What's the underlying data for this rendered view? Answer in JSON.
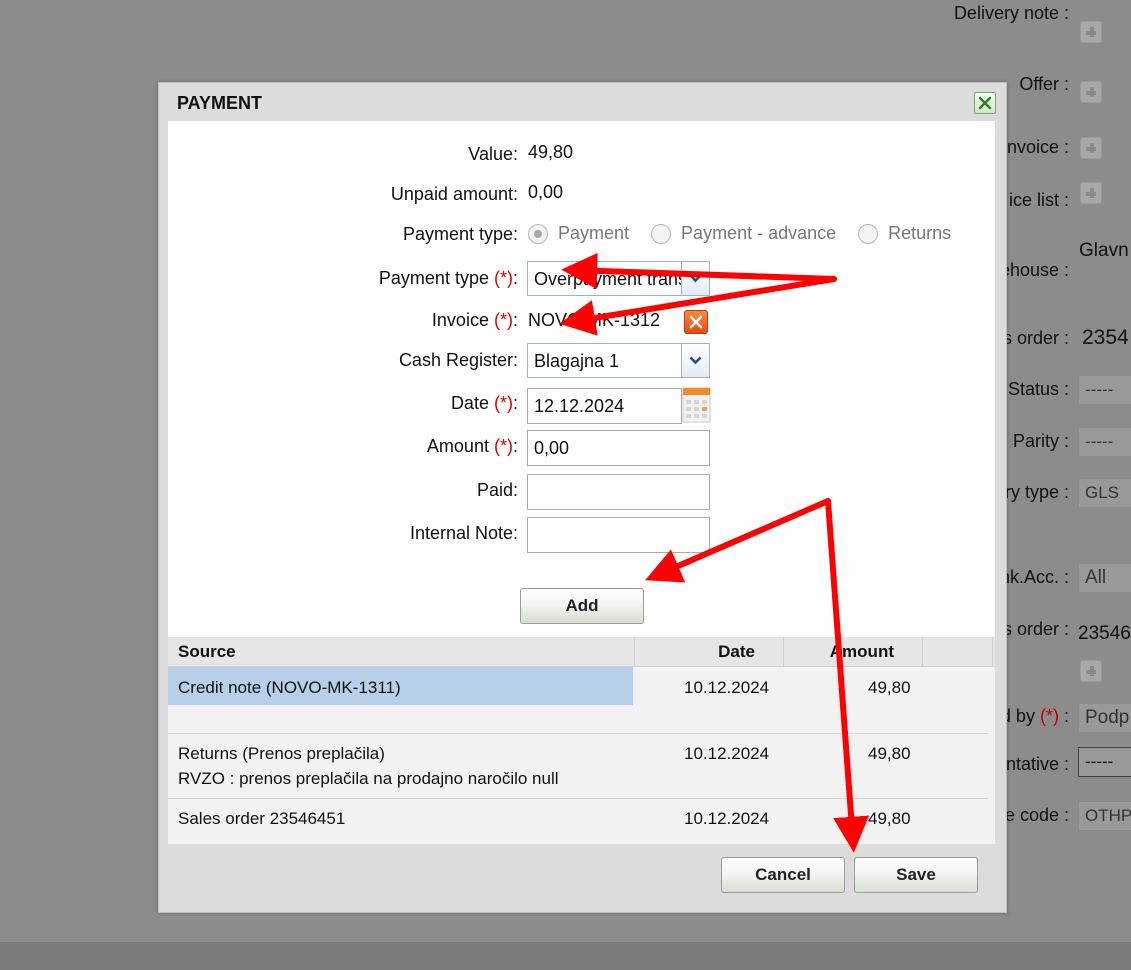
{
  "background": {
    "delivery_note_label": "Delivery note :",
    "offer_label": "Offer :",
    "invoice_label": "nvoice :",
    "price_list_label": "ice list :",
    "warehouse_label": "ehouse :",
    "warehouse_value": "Glavn",
    "order_label": "s order :",
    "order_value": "2354",
    "status_label": "Status :",
    "status_value": "-----",
    "parity_label": "Parity :",
    "parity_value": "-----",
    "delivery_type_label": "ry type :",
    "delivery_type_value": "GLS",
    "bank_acc_label": "nk.Acc. :",
    "bank_acc_value": "All",
    "sales_order_label": "s order :",
    "sales_order_value": "23546",
    "by_label": "d by",
    "by_req": "(*)",
    "by_colon": ":",
    "by_value": "Podp",
    "representative_label": "ntative :",
    "representative_value": "-----",
    "code_label": "e code :",
    "code_value": "OTHP"
  },
  "dialog": {
    "title": "PAYMENT",
    "close_icon": "close-icon",
    "value_label": "Value:",
    "value": "49,80",
    "unpaid_label": "Unpaid amount:",
    "unpaid": "0,00",
    "payment_type_radio_label": "Payment type:",
    "radios": [
      {
        "label": "Payment",
        "checked": true
      },
      {
        "label": "Payment - advance",
        "checked": false
      },
      {
        "label": "Returns",
        "checked": false
      }
    ],
    "payment_type_select_label": "Payment type",
    "required_mark": "(*)",
    "colon": ":",
    "payment_type_value": "Overpayment transfer",
    "invoice_label": "Invoice",
    "invoice_value": "NOVO-MK-1312",
    "cash_register_label": "Cash Register:",
    "cash_register_value": "Blagajna 1",
    "date_label": "Date",
    "date_value": "12.12.2024",
    "amount_label": "Amount",
    "amount_value": "0,00",
    "paid_label": "Paid:",
    "paid_value": "",
    "internal_note_label": "Internal Note:",
    "internal_note_value": "",
    "add_button": "Add",
    "table": {
      "headers": [
        "Source",
        "Date",
        "Amount"
      ],
      "rows": [
        {
          "source": "Credit note (NOVO-MK-1311)",
          "sub": "",
          "date": "10.12.2024",
          "amount": "49,80"
        },
        {
          "source": "Returns (Prenos preplačila)",
          "sub": "RVZO : prenos preplačila na prodajno naročilo null",
          "date": "10.12.2024",
          "amount": "49,80"
        },
        {
          "source": "Sales order 23546451",
          "sub": "",
          "date": "10.12.2024",
          "amount": "49,80"
        }
      ]
    },
    "cancel_button": "Cancel",
    "save_button": "Save"
  },
  "colors": {
    "accent_arrow": "#ff0000",
    "required": "#e00000",
    "selected_row": "#b7cfe9"
  }
}
